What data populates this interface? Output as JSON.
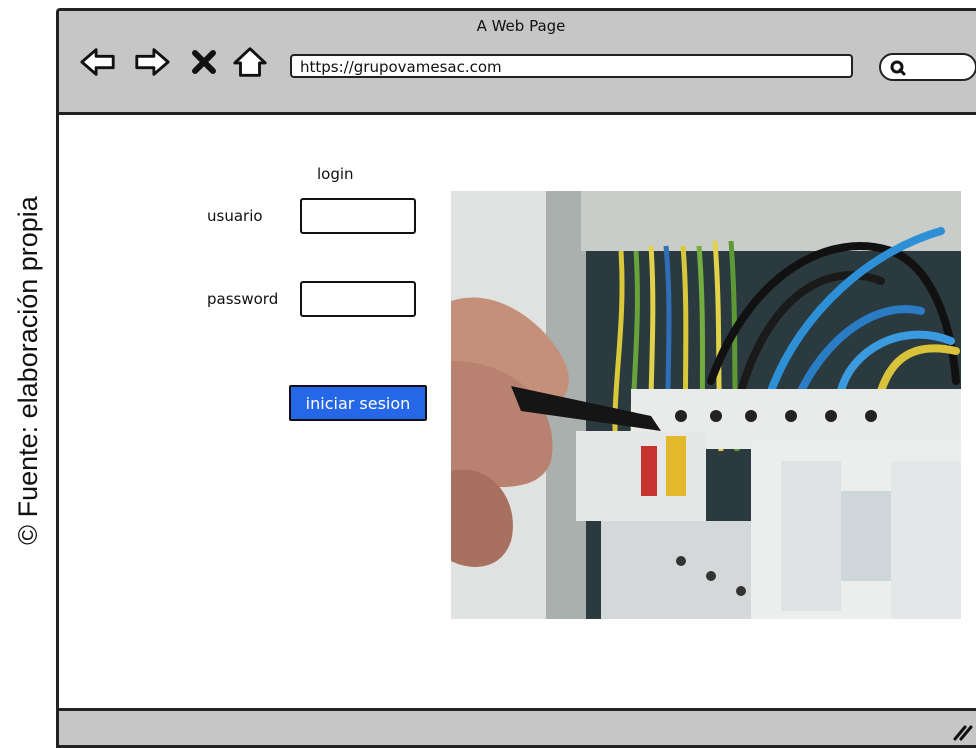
{
  "caption": "© Fuente: elaboración propia",
  "window": {
    "title": "A Web Page",
    "url": "https://grupovamesac.com",
    "nav_icons": [
      "back-arrow-icon",
      "forward-arrow-icon",
      "stop-x-icon",
      "home-icon"
    ],
    "search_icon": "search-icon"
  },
  "login": {
    "title": "login",
    "username_label": "usuario",
    "password_label": "password",
    "submit_label": "iniciar sesion",
    "button_color": "#2567e6"
  },
  "colors": {
    "chrome": "#c6c6c6",
    "border": "#222222"
  }
}
